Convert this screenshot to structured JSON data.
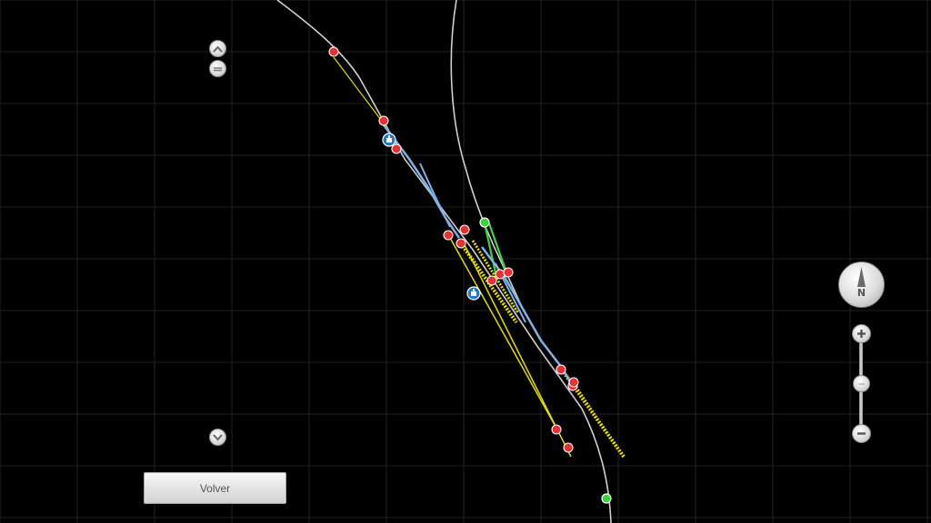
{
  "map": {
    "background": "#000000",
    "grid_color": "#2b2b2b",
    "track_gray_color": "#cfcfcf",
    "track_blue_color": "#7fb2e6",
    "track_yellow_color": "#e6dc00",
    "track_green_color": "#3fd43f",
    "marker_red_color": "#e83030",
    "marker_green_color": "#37d537",
    "marker_info_color": "#1f78c8"
  },
  "left_controls": {
    "scroll_up_icon": "chevron-up-icon",
    "collapse_icon": "minus-icon",
    "scroll_down_icon": "chevron-down-icon"
  },
  "compass": {
    "letter": "N",
    "icon": "north-arrow-icon"
  },
  "zoom": {
    "in_icon": "plus-icon",
    "out_icon": "minus-icon",
    "level": 0.5
  },
  "back_button": {
    "label": "Volver"
  }
}
